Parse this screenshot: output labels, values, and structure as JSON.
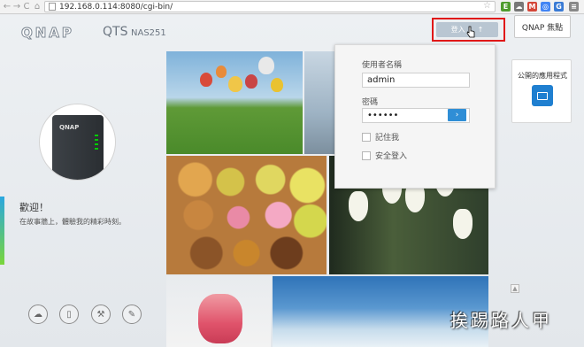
{
  "browser": {
    "url": "192.168.0.114:8080/cgi-bin/",
    "back_glyph": "←",
    "forward_glyph": "→",
    "reload_glyph": "C",
    "home_glyph": "⌂",
    "star_glyph": "☆",
    "extensions": [
      {
        "name": "evernote-icon",
        "color": "#4f9c2e",
        "glyph": "E"
      },
      {
        "name": "cloud-icon",
        "color": "#777777",
        "glyph": "☁"
      },
      {
        "name": "gmail-icon",
        "color": "#d44638",
        "glyph": "M"
      },
      {
        "name": "chrome-icon",
        "color": "#4285f4",
        "glyph": "◎"
      },
      {
        "name": "translate-icon",
        "color": "#3a7bd5",
        "glyph": "G"
      },
      {
        "name": "menu-icon",
        "color": "#888888",
        "glyph": "≡"
      }
    ]
  },
  "header": {
    "brand": "QNAP",
    "product": "QTS",
    "model": "NAS251",
    "login_button_label": "登入",
    "login_arrow": "↑",
    "qnap_point_label": "QNAP 焦點"
  },
  "left": {
    "device_logo": "QNAP",
    "welcome_title": "歡迎！",
    "welcome_subtitle": "在故事牆上，體驗我的精彩時刻。",
    "bottom_icons": [
      {
        "name": "cloud-link-icon",
        "glyph": "☁"
      },
      {
        "name": "mobile-app-icon",
        "glyph": "▯"
      },
      {
        "name": "tools-icon",
        "glyph": "⚒"
      },
      {
        "name": "feedback-icon",
        "glyph": "✎"
      }
    ]
  },
  "login": {
    "username_label": "使用者名稱",
    "username_value": "admin",
    "password_label": "密碼",
    "password_value": "••••••",
    "submit_glyph": "›",
    "remember_label": "記住我",
    "secure_label": "安全登入"
  },
  "right": {
    "public_apps_title": "公開的應用程式",
    "scroll_up_glyph": "▲"
  },
  "watermark": "挨踢路人甲",
  "colors": {
    "highlight_border": "#e01818",
    "primary_blue": "#2f8ed6",
    "login_button_bg": "#b9c6d2"
  }
}
